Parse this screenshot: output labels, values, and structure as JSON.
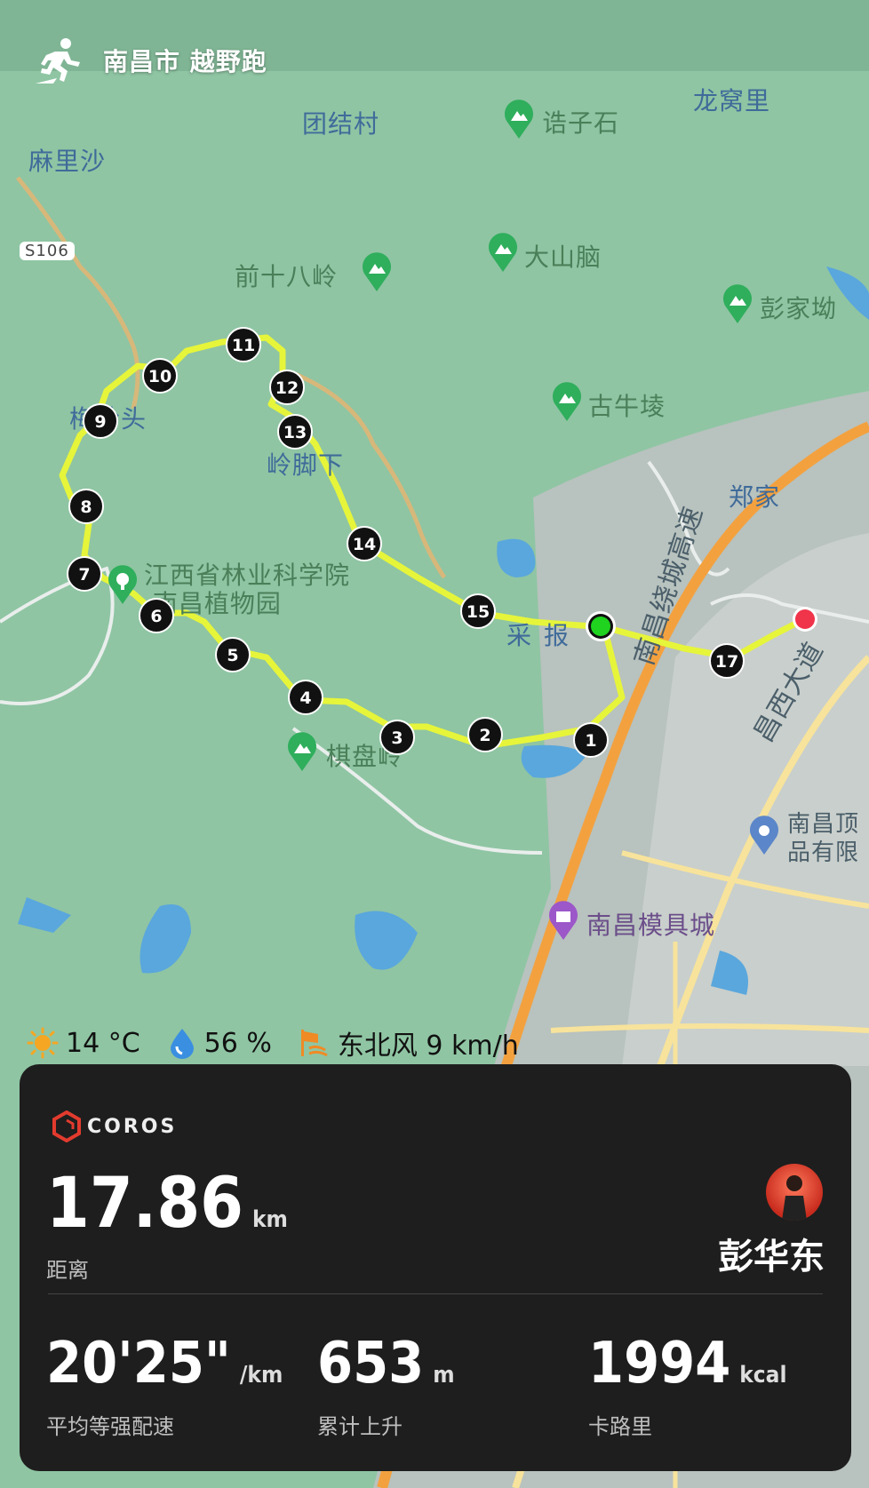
{
  "header": {
    "title": "南昌市 越野跑",
    "icon": "runner-icon"
  },
  "map": {
    "places": {
      "tuanjiecun": "团结村",
      "longwoli": "龙窝里",
      "malisha": "麻里沙",
      "gaozishi": "诰子石",
      "dashannao": "大山脑",
      "qianshibaling": "前十八岭",
      "pengjiaao": "彭家坳",
      "guniuling": "古牛堎",
      "meilingtou": "梅岭头",
      "lingjiaoxia": "岭脚下",
      "zhengjia": "郑家",
      "botanical": "江西省林业科学院·南昌植物园",
      "caibao": "采报",
      "qipanling": "棋盘岭",
      "highway": "南昌绕城高速",
      "dadao": "昌西大道",
      "company": "南昌顶品有限",
      "mojucheng": "南昌模具城",
      "road_badge": "S106"
    },
    "markers": [
      "1",
      "2",
      "3",
      "4",
      "5",
      "6",
      "7",
      "8",
      "9",
      "10",
      "11",
      "12",
      "13",
      "14",
      "15",
      "17"
    ]
  },
  "weather": {
    "temperature": "14 °C",
    "humidity": "56 %",
    "wind": "东北风 9 km/h"
  },
  "card": {
    "brand": "COROS",
    "distance": {
      "value": "17.86",
      "unit": "km",
      "label": "距离"
    },
    "pace": {
      "value": "20'25\"",
      "unit": "/km",
      "label": "平均等强配速"
    },
    "ascent": {
      "value": "653",
      "unit": "m",
      "label": "累计上升"
    },
    "calories": {
      "value": "1994",
      "unit": "kcal",
      "label": "卡路里"
    },
    "user": "彭华东"
  },
  "colors": {
    "route": "#e6f53a",
    "start": "#1fd31f",
    "end": "#f0344a",
    "map_green": "#8fc5a3",
    "card_bg": "#1e1e1e"
  }
}
